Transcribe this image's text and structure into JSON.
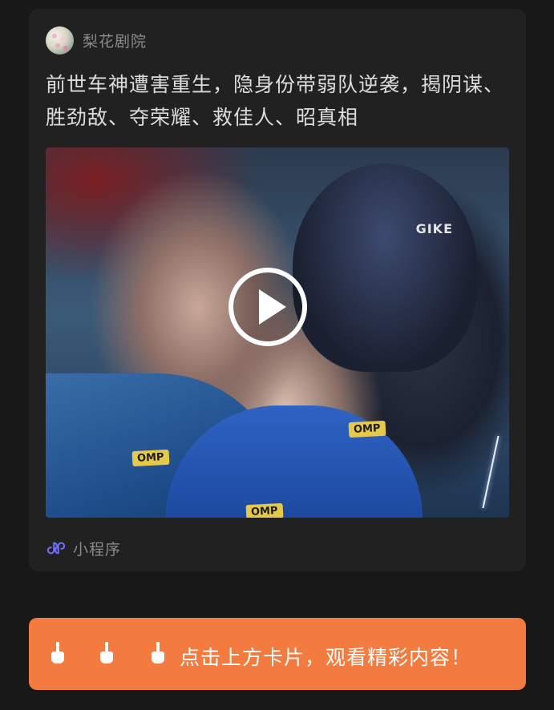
{
  "card": {
    "source_name": "梨花剧院",
    "headline": "前世车神遭害重生，隐身份带弱队逆袭，揭阴谋、胜劲敌、夺荣耀、救佳人、昭真相",
    "cover": {
      "helmet_text": "GIKE",
      "badges": [
        "OMP",
        "OMP",
        "OMP"
      ]
    },
    "footer_label": "小程序"
  },
  "cta": {
    "hand_icons": [
      "pointing-hand-icon",
      "pointing-hand-icon",
      "pointing-hand-icon"
    ],
    "text": "点击上方卡片，观看精彩内容！"
  },
  "colors": {
    "background": "#181818",
    "card": "#212121",
    "cta": "#f47b3f",
    "mini_program_icon": "#6b6cf2"
  }
}
